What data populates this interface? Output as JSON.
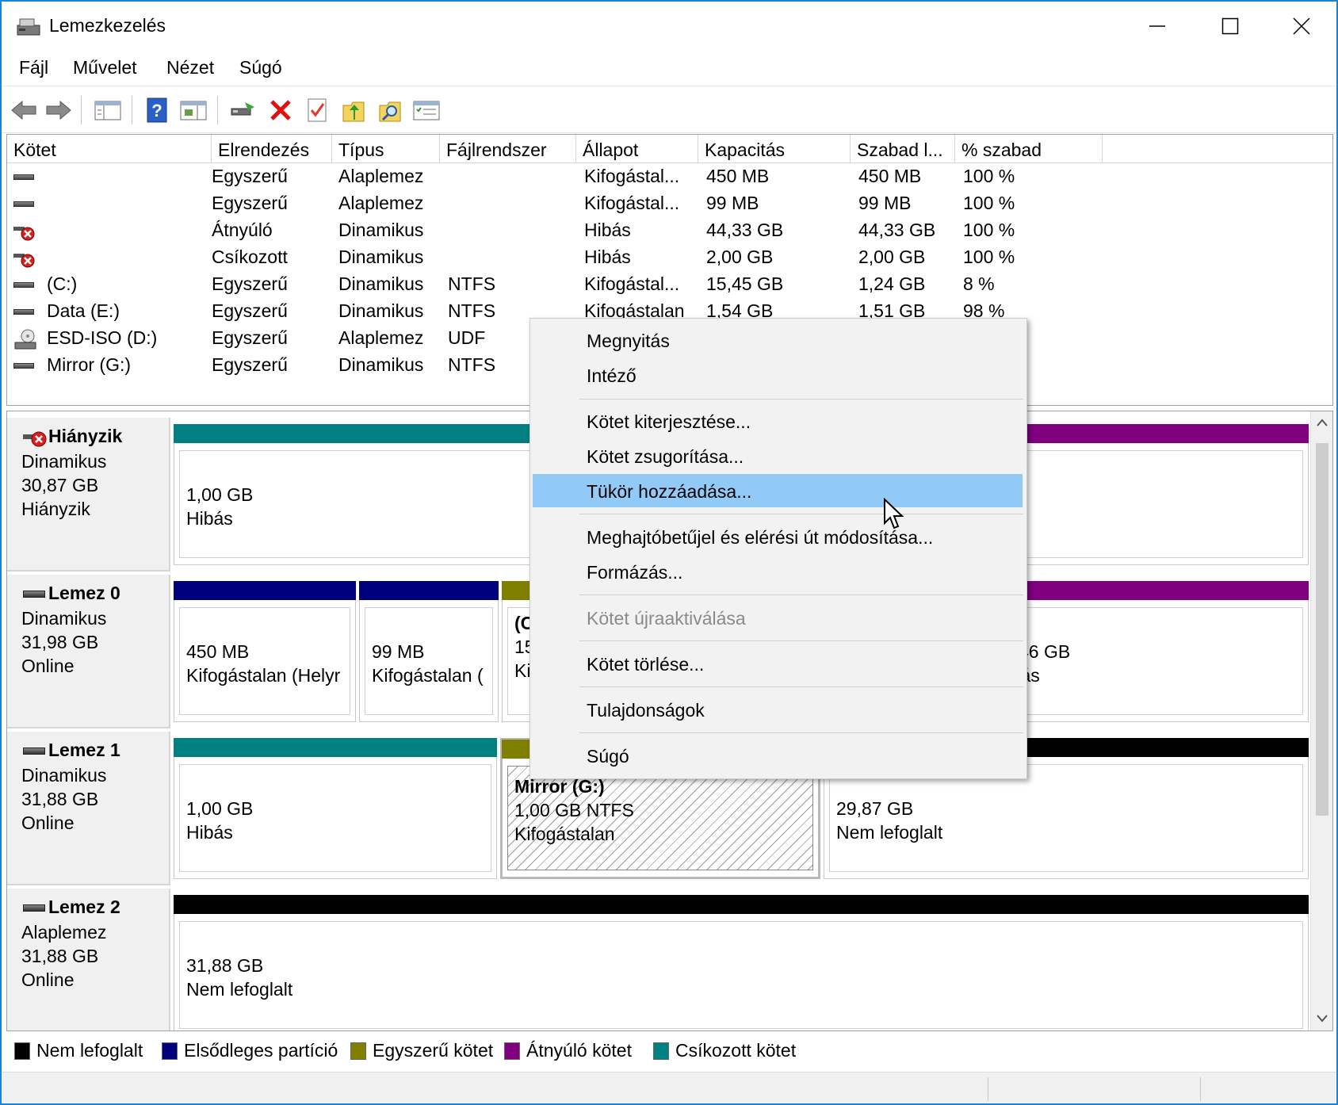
{
  "window": {
    "title": "Lemezkezelés"
  },
  "menu": [
    "Fájl",
    "Művelet",
    "Nézet",
    "Súgó"
  ],
  "columns": [
    "Kötet",
    "Elrendezés",
    "Típus",
    "Fájlrendszer",
    "Állapot",
    "Kapacitás",
    "Szabad l...",
    "% szabad"
  ],
  "volumes": [
    {
      "name": "",
      "layout": "Egyszerű",
      "type": "Alaplemez",
      "fs": "",
      "status": "Kifogástal...",
      "capacity": "450 MB",
      "free": "450 MB",
      "pct": "100 %",
      "icon": "disk-icon"
    },
    {
      "name": "",
      "layout": "Egyszerű",
      "type": "Alaplemez",
      "fs": "",
      "status": "Kifogástal...",
      "capacity": "99 MB",
      "free": "99 MB",
      "pct": "100 %",
      "icon": "disk-icon"
    },
    {
      "name": "",
      "layout": "Átnyúló",
      "type": "Dinamikus",
      "fs": "",
      "status": "Hibás",
      "capacity": "44,33 GB",
      "free": "44,33 GB",
      "pct": "100 %",
      "icon": "error-disk-icon"
    },
    {
      "name": "",
      "layout": "Csíkozott",
      "type": "Dinamikus",
      "fs": "",
      "status": "Hibás",
      "capacity": "2,00 GB",
      "free": "2,00 GB",
      "pct": "100 %",
      "icon": "error-disk-icon"
    },
    {
      "name": " (C:)",
      "layout": "Egyszerű",
      "type": "Dinamikus",
      "fs": "NTFS",
      "status": "Kifogástal...",
      "capacity": "15,45 GB",
      "free": "1,24 GB",
      "pct": "8 %",
      "icon": "disk-icon"
    },
    {
      "name": "Data (E:)",
      "layout": "Egyszerű",
      "type": "Dinamikus",
      "fs": "NTFS",
      "status": "Kifogástalan",
      "capacity": "1,54 GB",
      "free": "1,51 GB",
      "pct": "98 %",
      "icon": "disk-icon"
    },
    {
      "name": "ESD-ISO (D:)",
      "layout": "Egyszerű",
      "type": "Alaplemez",
      "fs": "UDF",
      "status": "",
      "capacity": "",
      "free": "",
      "pct": "",
      "icon": "cd-drive-icon"
    },
    {
      "name": "Mirror (G:)",
      "layout": "Egyszerű",
      "type": "Dinamikus",
      "fs": "NTFS",
      "status": "",
      "capacity": "",
      "free": "",
      "pct": "",
      "icon": "disk-icon"
    }
  ],
  "disks": [
    {
      "name": "Hiányzik",
      "l1": "Dinamikus",
      "l2": "30,87 GB",
      "l3": "Hiányzik",
      "parts": [
        {
          "l1": "1,00 GB",
          "l2": "Hibás"
        },
        {
          "l1": "",
          "l2": ""
        }
      ]
    },
    {
      "name": "Lemez 0",
      "l1": "Dinamikus",
      "l2": "31,98 GB",
      "l3": "Online",
      "parts": [
        {
          "l1": "450 MB",
          "l2": "Kifogástalan (Helyr"
        },
        {
          "l1": "99 MB",
          "l2": "Kifogástalan ("
        },
        {
          "l0": "(C",
          "l1": "15,",
          "l2": "Kif"
        },
        {
          "l1": "14,46 GB",
          "l2": "Hibás"
        }
      ]
    },
    {
      "name": "Lemez 1",
      "l1": "Dinamikus",
      "l2": "31,88 GB",
      "l3": "Online",
      "parts": [
        {
          "l1": "1,00 GB",
          "l2": "Hibás"
        },
        {
          "l0": "Mirror  (G:)",
          "l1": "1,00 GB NTFS",
          "l2": "Kifogástalan"
        },
        {
          "l1": "29,87 GB",
          "l2": "Nem lefoglalt"
        }
      ]
    },
    {
      "name": "Lemez 2",
      "l1": "Alaplemez",
      "l2": "31,88 GB",
      "l3": "Online",
      "parts": [
        {
          "l1": "31,88 GB",
          "l2": "Nem lefoglalt"
        }
      ]
    }
  ],
  "legend": [
    "Nem lefoglalt",
    "Elsődleges partíció",
    "Egyszerű kötet",
    "Átnyúló kötet",
    "Csíkozott kötet"
  ],
  "colors": {
    "unallocated": "#000000",
    "primary": "#00007f",
    "simple": "#7f7f00",
    "spanned": "#800080",
    "striped": "#008080",
    "highlight": "#91c9f7"
  },
  "context_menu": [
    "Megnyitás",
    "Intéző",
    "Kötet kiterjesztése...",
    "Kötet zsugorítása...",
    "Tükör hozzáadása...",
    "Meghajtóbetűjel és elérési út módosítása...",
    "Formázás...",
    "Kötet újraaktiválása",
    "Kötet törlése...",
    "Tulajdonságok",
    "Súgó"
  ]
}
